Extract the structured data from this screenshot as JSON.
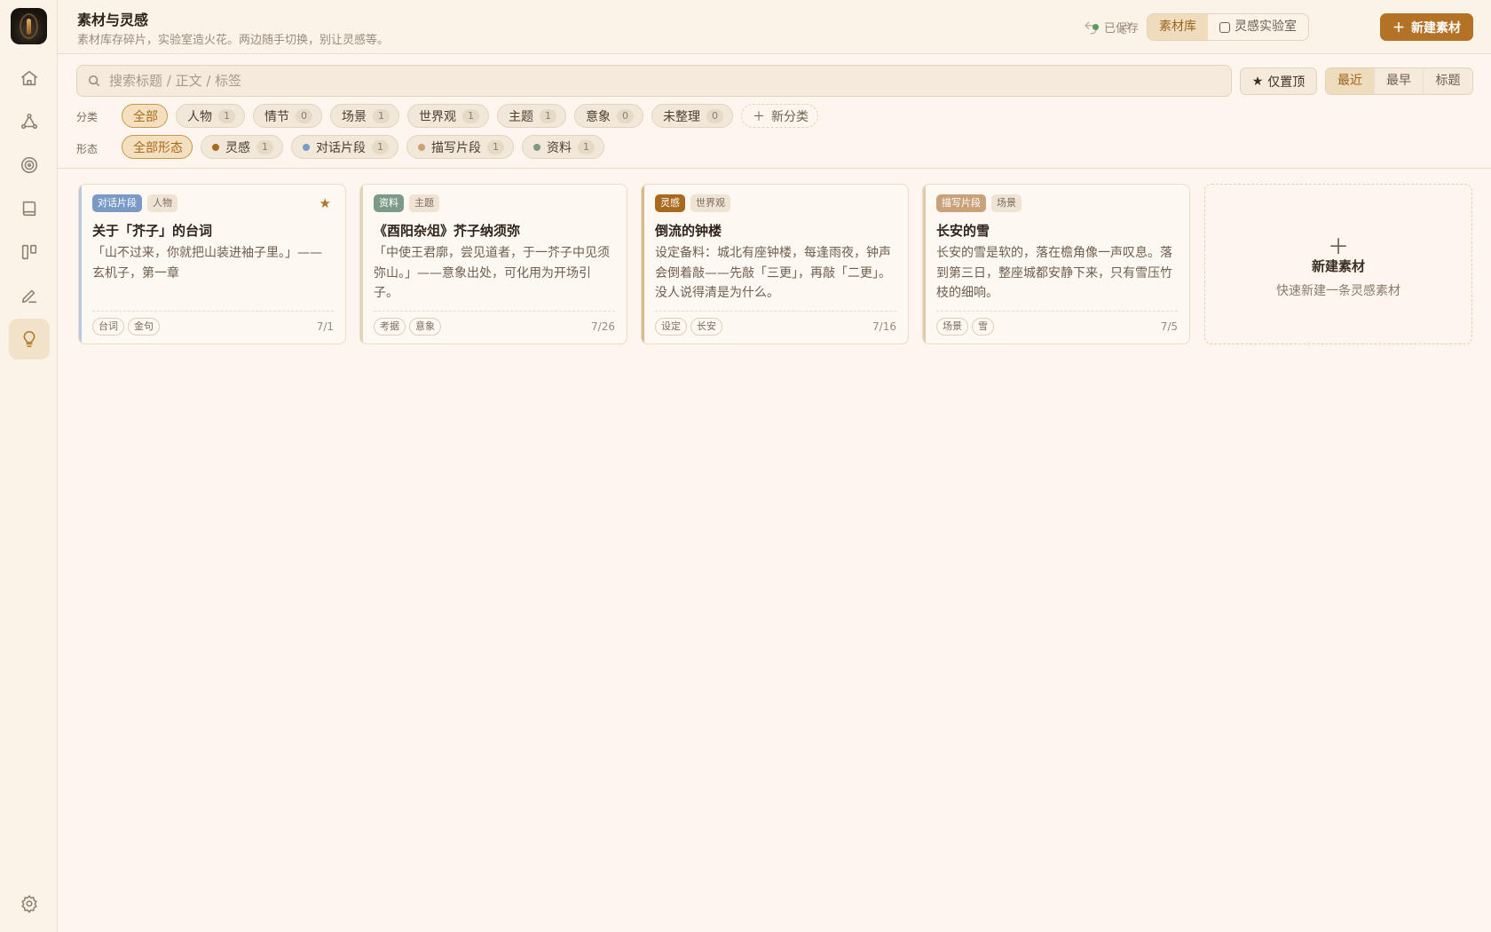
{
  "header": {
    "title": "素材与灵感",
    "subtitle": "素材库存碎片，实验室造火花。两边随手切换，别让灵感等。",
    "saved_label": "已保存",
    "views": [
      {
        "label": "素材库",
        "active": true
      },
      {
        "label": "灵感实验室",
        "active": false
      }
    ],
    "new_button": "新建素材"
  },
  "search": {
    "placeholder": "搜索标题 / 正文 / 标签",
    "value": ""
  },
  "pin_filter": "仅置顶",
  "sort": [
    {
      "label": "最近",
      "active": true
    },
    {
      "label": "最早",
      "active": false
    },
    {
      "label": "标题",
      "active": false
    }
  ],
  "category": {
    "label": "分类",
    "chips": [
      {
        "label": "全部",
        "count": "",
        "active": true
      },
      {
        "label": "人物",
        "count": "1"
      },
      {
        "label": "情节",
        "count": "0"
      },
      {
        "label": "场景",
        "count": "1"
      },
      {
        "label": "世界观",
        "count": "1"
      },
      {
        "label": "主题",
        "count": "1"
      },
      {
        "label": "意象",
        "count": "0"
      },
      {
        "label": "未整理",
        "count": "0"
      }
    ],
    "add_label": "新分类"
  },
  "form": {
    "label": "形态",
    "chips": [
      {
        "label": "全部形态",
        "count": "",
        "active": true,
        "color": ""
      },
      {
        "label": "灵感",
        "count": "1",
        "color": "#a86a1e"
      },
      {
        "label": "对话片段",
        "count": "1",
        "color": "#7a9ac8"
      },
      {
        "label": "描写片段",
        "count": "1",
        "color": "#c9a27a"
      },
      {
        "label": "资料",
        "count": "1",
        "color": "#7c9a86"
      }
    ]
  },
  "cards": [
    {
      "form": "对话片段",
      "form_color": "#7a9ac8",
      "category": "人物",
      "title": "关于「芥子」的台词",
      "body": "「山不过来，你就把山装进袖子里。」——玄机子，第一章",
      "tags": [
        "台词",
        "金句"
      ],
      "date": "7/1",
      "pinned": true
    },
    {
      "form": "资料",
      "form_color": "#7c9a86",
      "category": "主题",
      "title": "《酉阳杂俎》芥子纳须弥",
      "body": "「中使王君廓，尝见道者，于一芥子中见须弥山。」——意象出处，可化用为开场引子。",
      "tags": [
        "考据",
        "意象"
      ],
      "date": "7/26",
      "pinned": false
    },
    {
      "form": "灵感",
      "form_color": "#a86a1e",
      "category": "世界观",
      "title": "倒流的钟楼",
      "body": "设定备料：城北有座钟楼，每逢雨夜，钟声会倒着敲——先敲「三更」，再敲「二更」。没人说得清是为什么。",
      "tags": [
        "设定",
        "长安"
      ],
      "date": "7/16",
      "pinned": false
    },
    {
      "form": "描写片段",
      "form_color": "#c9a27a",
      "category": "场景",
      "title": "长安的雪",
      "body": "长安的雪是软的，落在檐角像一声叹息。落到第三日，整座城都安静下来，只有雪压竹枝的细响。",
      "tags": [
        "场景",
        "雪"
      ],
      "date": "7/5",
      "pinned": false
    }
  ],
  "new_card": {
    "title": "新建素材",
    "subtitle": "快速新建一条灵感素材"
  },
  "nav": [
    "home-icon",
    "graph-icon",
    "target-icon",
    "book-icon",
    "board-icon",
    "pen-icon",
    "bulb-icon",
    "settings-icon"
  ],
  "colors": {
    "accent": "#b37225",
    "background": "#fcf6ee"
  }
}
